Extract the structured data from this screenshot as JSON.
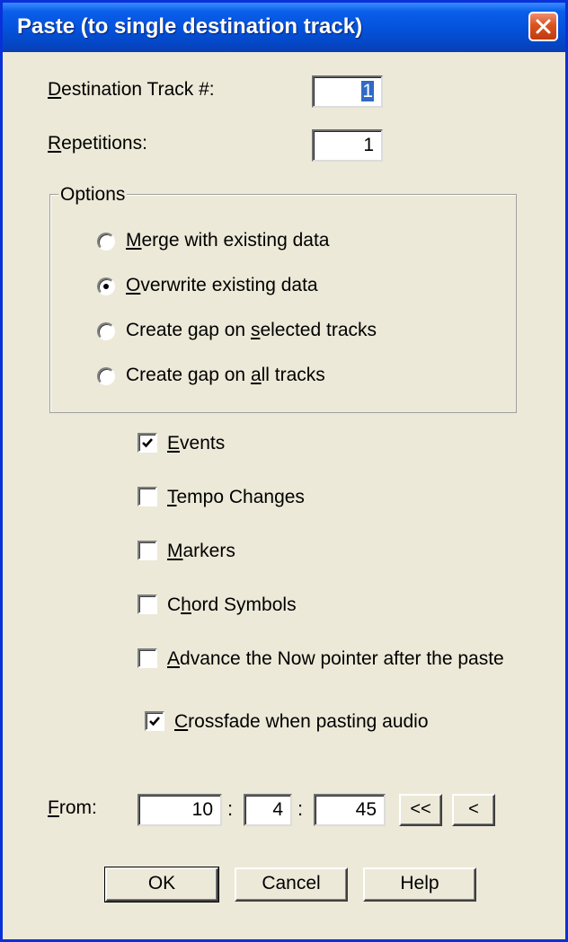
{
  "dialog": {
    "title": "Paste (to single destination track)"
  },
  "fields": {
    "destination_track": {
      "label_first": "D",
      "label_rest": "estination Track #:",
      "value": "1"
    },
    "repetitions": {
      "label_first": "R",
      "label_rest": "epetitions:",
      "value": "1"
    }
  },
  "options": {
    "group_label": "Options",
    "radios": [
      {
        "pre": "",
        "key": "M",
        "post": "erge with existing data",
        "checked": false
      },
      {
        "pre": "",
        "key": "O",
        "post": "verwrite existing data",
        "checked": true
      },
      {
        "pre": "Create gap on ",
        "key": "s",
        "post": "elected tracks",
        "checked": false
      },
      {
        "pre": "Create gap on ",
        "key": "a",
        "post": "ll tracks",
        "checked": false
      }
    ]
  },
  "checkboxes": [
    {
      "pre": "",
      "key": "E",
      "post": "vents",
      "checked": true
    },
    {
      "pre": "",
      "key": "T",
      "post": "empo Changes",
      "checked": false
    },
    {
      "pre": "",
      "key": "M",
      "post": "arkers",
      "checked": false
    },
    {
      "pre": "C",
      "key": "h",
      "post": "ord Symbols",
      "checked": false
    },
    {
      "pre": "",
      "key": "A",
      "post": "dvance the Now pointer after the paste",
      "checked": false
    },
    {
      "pre": "",
      "key": "C",
      "post": "rossfade when pasting audio",
      "checked": true
    }
  ],
  "from": {
    "label_first": "F",
    "label_rest": "rom:",
    "bar": "10",
    "beat": "4",
    "tick": "45",
    "separator": ":",
    "rewind_label": "<<",
    "back_label": "<"
  },
  "buttons": {
    "ok": "OK",
    "cancel": "Cancel",
    "help": "Help"
  },
  "colors": {
    "title_bar": "#0453dd",
    "dialog_bg": "#ece9d8",
    "close_button": "#d9531f",
    "selection": "#316ac5"
  }
}
